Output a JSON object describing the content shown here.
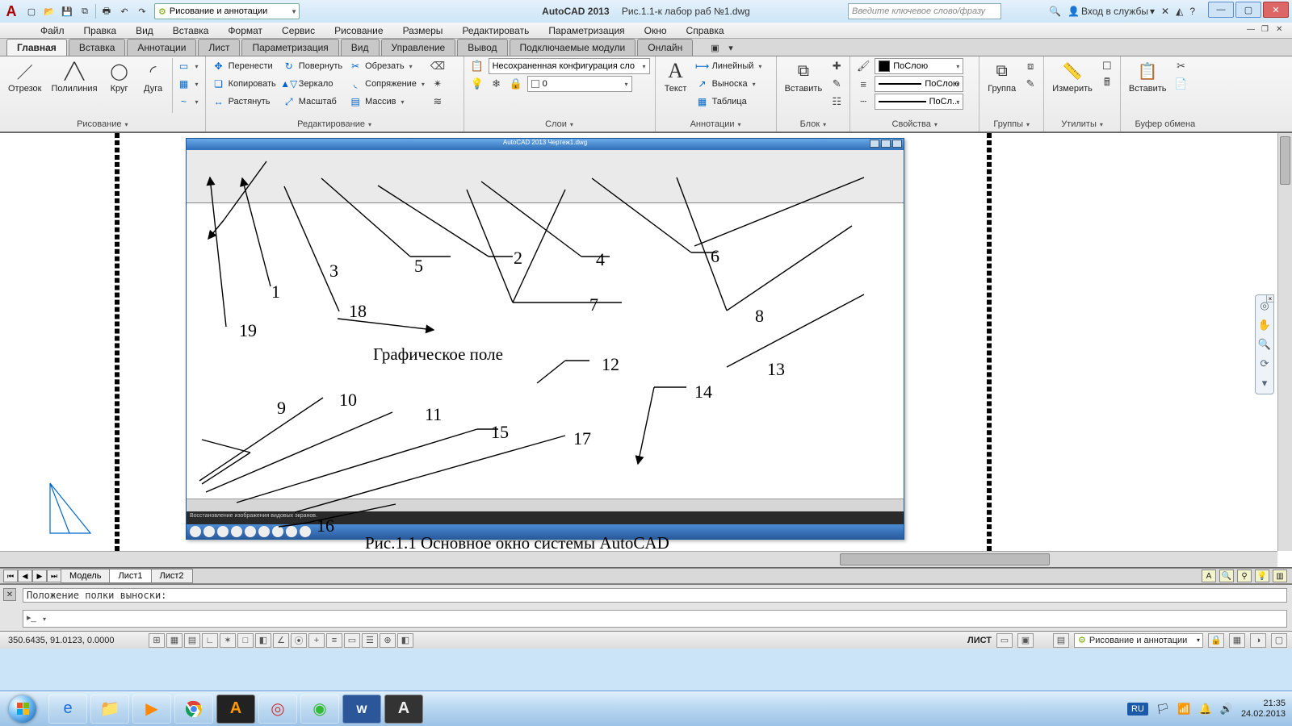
{
  "titlebar": {
    "app": "AutoCAD 2013",
    "file": "Рис.1.1-к лабор раб №1.dwg",
    "workspace": "Рисование и аннотации",
    "search_placeholder": "Введите ключевое слово/фразу",
    "sign_in": "Вход в службы"
  },
  "menubar": [
    "Файл",
    "Правка",
    "Вид",
    "Вставка",
    "Формат",
    "Сервис",
    "Рисование",
    "Размеры",
    "Редактировать",
    "Параметризация",
    "Окно",
    "Справка"
  ],
  "ribbon_tabs": [
    "Главная",
    "Вставка",
    "Аннотации",
    "Лист",
    "Параметризация",
    "Вид",
    "Управление",
    "Вывод",
    "Подключаемые модули",
    "Онлайн"
  ],
  "panels": {
    "draw": {
      "title": "Рисование",
      "big": [
        "Отрезок",
        "Полилиния",
        "Круг",
        "Дуга"
      ]
    },
    "modify": {
      "title": "Редактирование",
      "col1": [
        "Перенести",
        "Копировать",
        "Растянуть"
      ],
      "col2": [
        "Повернуть",
        "Зеркало",
        "Масштаб"
      ],
      "col3": [
        "Обрезать",
        "Сопряжение",
        "Массив"
      ]
    },
    "layers": {
      "title": "Слои",
      "current": "Несохраненная конфигурация сло",
      "zero_layer": "0"
    },
    "annot": {
      "title": "Аннотации",
      "text": "Текст",
      "items": [
        "Линейный",
        "Выноска",
        "Таблица"
      ]
    },
    "block": {
      "title": "Блок",
      "insert": "Вставить"
    },
    "props": {
      "title": "Свойства",
      "bylayer": "ПоСлою",
      "bylayer2": "ПоСлою",
      "bylayer3": "ПоСл..."
    },
    "groups": {
      "title": "Группы",
      "btn": "Группа"
    },
    "utils": {
      "title": "Утилиты",
      "btn": "Измерить"
    },
    "clip": {
      "title": "Буфер обмена",
      "btn": "Вставить"
    }
  },
  "canvas": {
    "callouts": {
      "1": "1",
      "2": "2",
      "3": "3",
      "4": "4",
      "5": "5",
      "6": "6",
      "7": "7",
      "8": "8",
      "9": "9",
      "10": "10",
      "11": "11",
      "12": "12",
      "13": "13",
      "14": "14",
      "15": "15",
      "16": "16",
      "17": "17",
      "18": "18",
      "19": "19"
    },
    "graphic_field": "Графическое поле",
    "caption": "Рис.1.1 Основное окно системы AutoCAD",
    "embedded_title": "AutoCAD 2013    Чертеж1.dwg",
    "embedded_cmd": "Восстановление изображения видовых экранов."
  },
  "layout_tabs": [
    "Модель",
    "Лист1",
    "Лист2"
  ],
  "command": {
    "history": "Положение полки выноски:",
    "prompt": ""
  },
  "statusbar": {
    "coords": "350.6435, 91.0123, 0.0000",
    "space": "ЛИСТ",
    "workspace": "Рисование и аннотации"
  },
  "taskbar": {
    "lang": "RU",
    "time": "21:35",
    "date": "24.02.2013"
  }
}
